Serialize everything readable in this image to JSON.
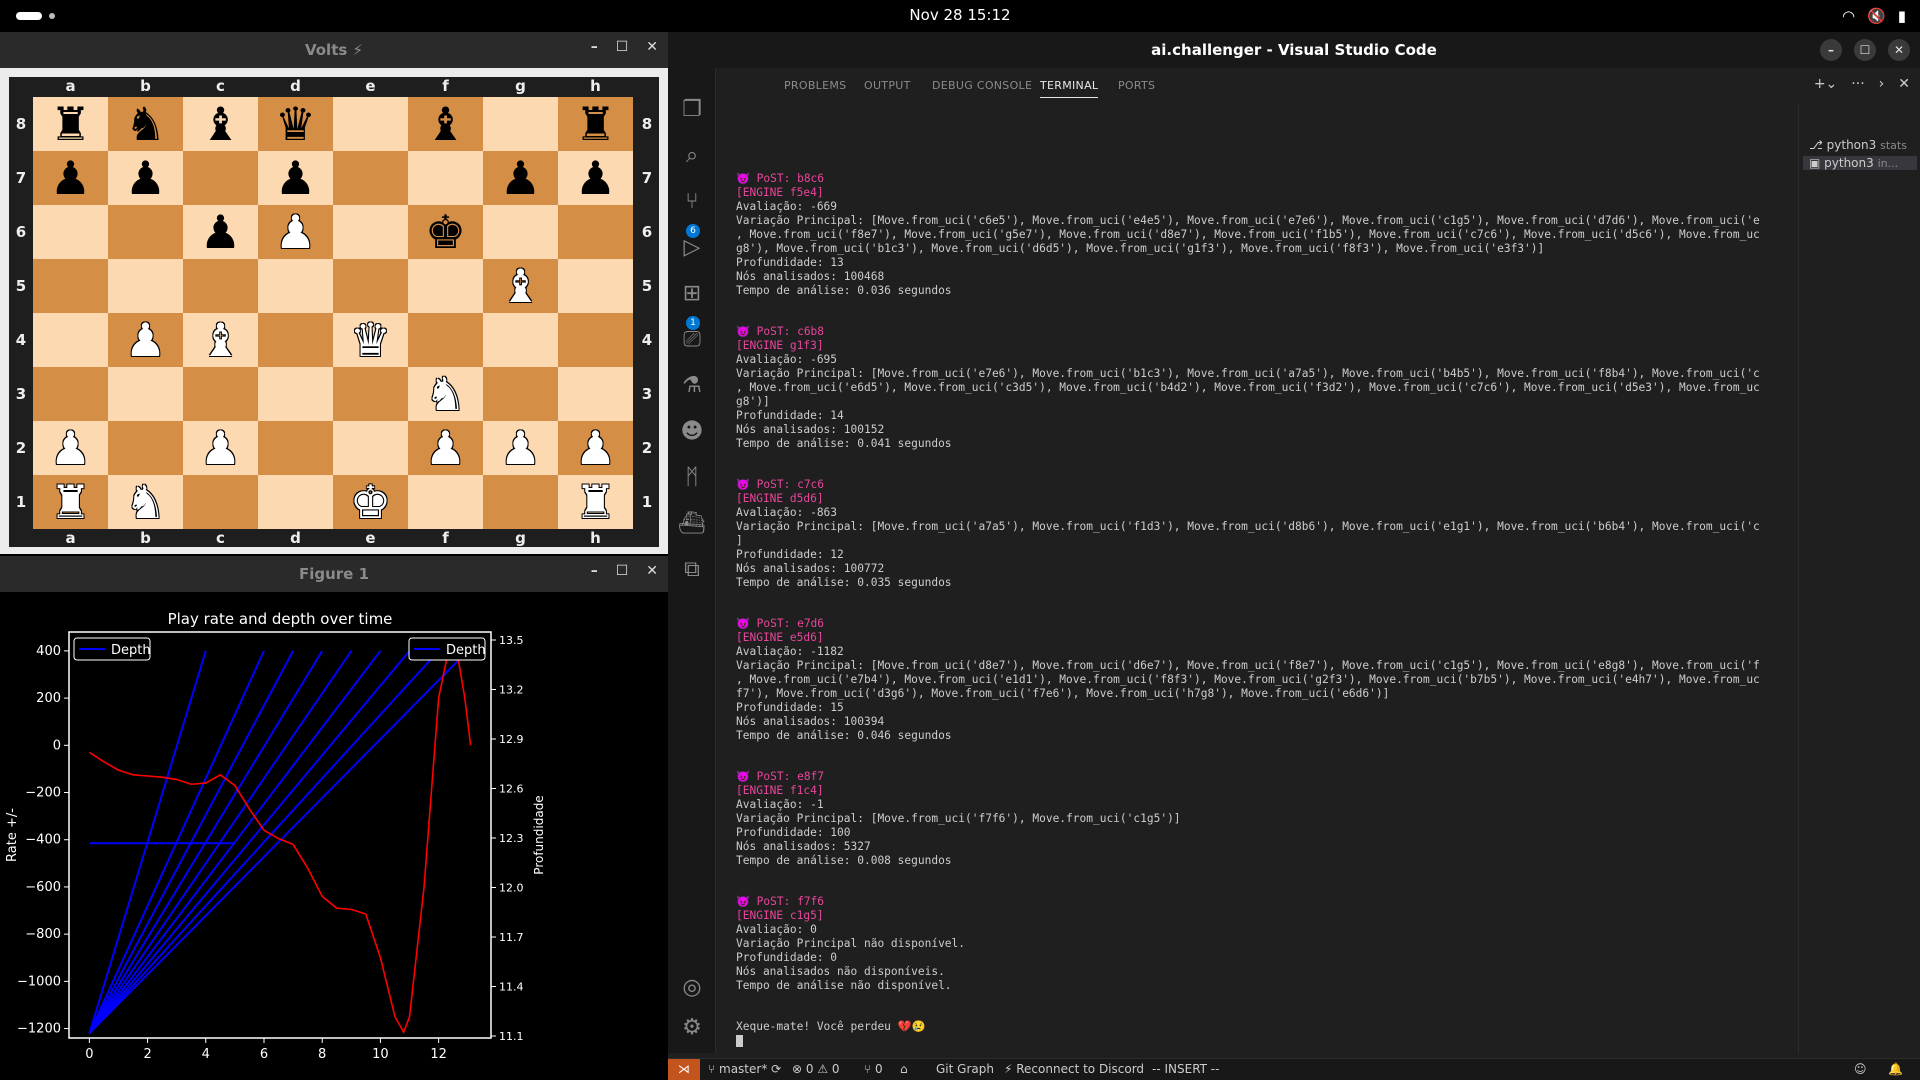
{
  "topbar": {
    "clock": "Nov 28  15:12",
    "tray": [
      "wifi-icon",
      "mute-icon",
      "battery-icon"
    ]
  },
  "chess_window": {
    "title": "Volts ⚡",
    "files": [
      "a",
      "b",
      "c",
      "d",
      "e",
      "f",
      "g",
      "h"
    ],
    "ranks": [
      "8",
      "7",
      "6",
      "5",
      "4",
      "3",
      "2",
      "1"
    ],
    "board": [
      [
        "♜b",
        "♞b",
        "♝b",
        "♛b",
        "",
        "♝b",
        "",
        "♜b"
      ],
      [
        "♟b",
        "♟b",
        "",
        "♟b",
        "",
        "",
        "♟b",
        "♟b"
      ],
      [
        "",
        "",
        "♟b",
        "♙w",
        "",
        "♚b",
        "",
        ""
      ],
      [
        "",
        "",
        "",
        "",
        "",
        "",
        "♗w",
        ""
      ],
      [
        "",
        "♙w",
        "♗w",
        "",
        "♕w",
        "",
        "",
        ""
      ],
      [
        "",
        "",
        "",
        "",
        "",
        "♘w",
        "",
        ""
      ],
      [
        "♙w",
        "",
        "♙w",
        "",
        "",
        "♙w",
        "♙w",
        "♙w"
      ],
      [
        "♖w",
        "♘w",
        "",
        "",
        "♔w",
        "",
        "",
        "♖w"
      ]
    ]
  },
  "figure_window": {
    "title": "Figure 1"
  },
  "chart_data": {
    "type": "line",
    "title": "Play rate and depth over time",
    "ylabel": "Rate +/-",
    "y2label": "Profundidade",
    "legend_left": "Depth",
    "legend_right": "Depth",
    "xlim": [
      -0.7,
      13.8
    ],
    "ylim": [
      -1240,
      480
    ],
    "x_ticks": [
      "0",
      "2",
      "4",
      "6",
      "8",
      "10",
      "12"
    ],
    "y_ticks": [
      "400",
      "200",
      "0",
      "−200",
      "−400",
      "−600",
      "−800",
      "−1000",
      "−1200"
    ],
    "right_ticks": [
      "13.5",
      "13.2",
      "12.9",
      "12.6",
      "12.3",
      "12.0",
      "11.7",
      "11.4",
      "11.1"
    ],
    "depth_lines": [
      {
        "x": [
          0,
          4
        ],
        "y": [
          -1220,
          400
        ]
      },
      {
        "x": [
          0,
          6
        ],
        "y": [
          -1220,
          400
        ]
      },
      {
        "x": [
          0,
          7
        ],
        "y": [
          -1220,
          400
        ]
      },
      {
        "x": [
          0,
          8
        ],
        "y": [
          -1220,
          400
        ]
      },
      {
        "x": [
          0,
          9
        ],
        "y": [
          -1220,
          400
        ]
      },
      {
        "x": [
          0,
          10
        ],
        "y": [
          -1220,
          400
        ]
      },
      {
        "x": [
          0,
          11
        ],
        "y": [
          -1220,
          400
        ]
      },
      {
        "x": [
          0,
          12
        ],
        "y": [
          -1220,
          400
        ]
      },
      {
        "x": [
          0,
          13
        ],
        "y": [
          -1220,
          400
        ]
      },
      {
        "x": [
          0,
          5
        ],
        "y": [
          -415,
          -415
        ]
      }
    ],
    "rate_series": {
      "name": "Rate",
      "x": [
        0,
        0.5,
        1,
        1.5,
        2,
        2.5,
        3,
        3.5,
        4,
        4.5,
        5,
        5.5,
        6,
        6.5,
        7,
        7.5,
        8,
        8.5,
        9,
        9.5,
        10,
        10.5,
        10.8,
        11,
        11.5,
        12,
        12.3,
        12.6,
        12.9,
        13.1
      ],
      "y": [
        -30,
        -70,
        -105,
        -125,
        -130,
        -135,
        -145,
        -165,
        -160,
        -125,
        -170,
        -270,
        -360,
        -395,
        -420,
        -520,
        -640,
        -690,
        -695,
        -715,
        -900,
        -1150,
        -1215,
        -1150,
        -600,
        200,
        380,
        420,
        200,
        0
      ]
    }
  },
  "vscode": {
    "title": "ai.challenger - Visual Studio Code",
    "panel_tabs": [
      "PROBLEMS",
      "OUTPUT",
      "DEBUG CONSOLE",
      "TERMINAL",
      "PORTS"
    ],
    "active_tab": "TERMINAL",
    "terminals": [
      {
        "label": "python3",
        "sub": "stats"
      },
      {
        "label": "python3",
        "sub": "in..."
      }
    ],
    "activity_badges": {
      "scm": "6",
      "extensions": "1"
    },
    "terminal_blocks": [
      {
        "post": "😈 PoST: b8c6",
        "engine": "[ENGINE f5e4]",
        "lines": [
          "Avaliação: -669",
          "Variação Principal: [Move.from_uci('c6e5'), Move.from_uci('e4e5'), Move.from_uci('e7e6'), Move.from_uci('c1g5'), Move.from_uci('d7d6'), Move.from_uci('e",
          ", Move.from_uci('f8e7'), Move.from_uci('g5e7'), Move.from_uci('d8e7'), Move.from_uci('f1b5'), Move.from_uci('c7c6'), Move.from_uci('d5c6'), Move.from_uc",
          "g8'), Move.from_uci('b1c3'), Move.from_uci('d6d5'), Move.from_uci('g1f3'), Move.from_uci('f8f3'), Move.from_uci('e3f3')]",
          "Profundidade: 13",
          "Nós analisados: 100468",
          "Tempo de análise: 0.036 segundos"
        ]
      },
      {
        "post": "😈 PoST: c6b8",
        "engine": "[ENGINE g1f3]",
        "lines": [
          "Avaliação: -695",
          "Variação Principal: [Move.from_uci('e7e6'), Move.from_uci('b1c3'), Move.from_uci('a7a5'), Move.from_uci('b4b5'), Move.from_uci('f8b4'), Move.from_uci('c",
          ", Move.from_uci('e6d5'), Move.from_uci('c3d5'), Move.from_uci('b4d2'), Move.from_uci('f3d2'), Move.from_uci('c7c6'), Move.from_uci('d5e3'), Move.from_uc",
          "g8')]",
          "Profundidade: 14",
          "Nós analisados: 100152",
          "Tempo de análise: 0.041 segundos"
        ]
      },
      {
        "post": "😈 PoST: c7c6",
        "engine": "[ENGINE d5d6]",
        "lines": [
          "Avaliação: -863",
          "Variação Principal: [Move.from_uci('a7a5'), Move.from_uci('f1d3'), Move.from_uci('d8b6'), Move.from_uci('e1g1'), Move.from_uci('b6b4'), Move.from_uci('c",
          "]",
          "Profundidade: 12",
          "Nós analisados: 100772",
          "Tempo de análise: 0.035 segundos"
        ]
      },
      {
        "post": "😈 PoST: e7d6",
        "engine": "[ENGINE e5d6]",
        "lines": [
          "Avaliação: -1182",
          "Variação Principal: [Move.from_uci('d8e7'), Move.from_uci('d6e7'), Move.from_uci('f8e7'), Move.from_uci('c1g5'), Move.from_uci('e8g8'), Move.from_uci('f",
          ", Move.from_uci('e7b4'), Move.from_uci('e1d1'), Move.from_uci('f8f3'), Move.from_uci('g2f3'), Move.from_uci('b7b5'), Move.from_uci('e4h7'), Move.from_uc",
          "f7'), Move.from_uci('d3g6'), Move.from_uci('f7e6'), Move.from_uci('h7g8'), Move.from_uci('e6d6')]",
          "Profundidade: 15",
          "Nós analisados: 100394",
          "Tempo de análise: 0.046 segundos"
        ]
      },
      {
        "post": "😈 PoST: e8f7",
        "engine": "[ENGINE f1c4]",
        "lines": [
          "Avaliação: -1",
          "Variação Principal: [Move.from_uci('f7f6'), Move.from_uci('c1g5')]",
          "Profundidade: 100",
          "Nós analisados: 5327",
          "Tempo de análise: 0.008 segundos"
        ]
      },
      {
        "post": "😈 PoST: f7f6",
        "engine": "[ENGINE c1g5]",
        "lines": [
          "Avaliação: 0",
          "Variação Principal não disponível.",
          "Profundidade: 0",
          "Nós analisados não disponíveis.",
          "Tempo de análise não disponível."
        ]
      }
    ],
    "final_line": "Xeque-mate! Você perdeu 💔😢",
    "statusbar": {
      "branch": "master*",
      "errors": "⊗ 0 ⚠ 0",
      "ports": "⑂ 0",
      "git_graph": "Git Graph",
      "discord": "Reconnect to Discord",
      "mode": "-- INSERT --"
    }
  }
}
